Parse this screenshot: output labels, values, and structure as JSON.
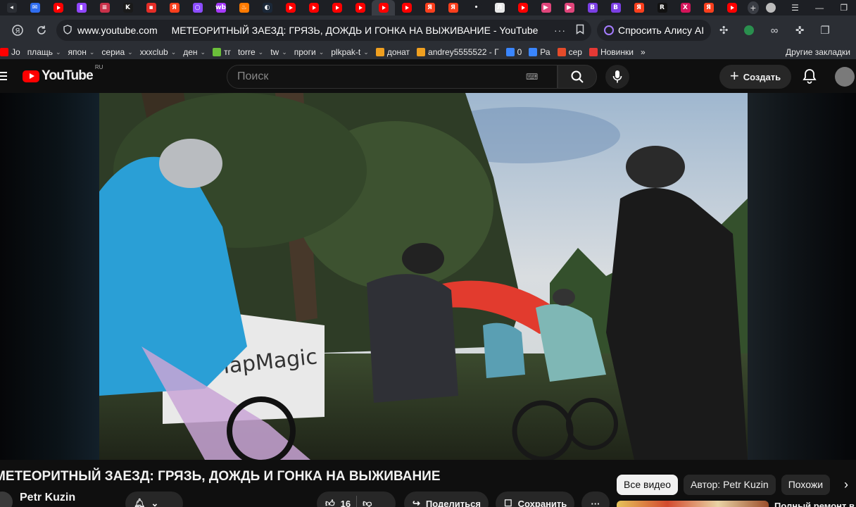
{
  "browser": {
    "tabs": [
      {
        "icon": "ya-icon",
        "color": "#2b2e34",
        "glyph": "◂"
      },
      {
        "icon": "mail-icon",
        "color": "#2f6df0",
        "glyph": "✉"
      },
      {
        "icon": "youtube-icon",
        "color": "#ff0000",
        "glyph": ""
      },
      {
        "icon": "twitch-icon",
        "color": "#9146ff",
        "glyph": "▮"
      },
      {
        "icon": "bookmark-icon",
        "color": "#c9314a",
        "glyph": "≡"
      },
      {
        "icon": "kinopoisk-icon",
        "color": "#1a1a1a",
        "glyph": "K"
      },
      {
        "icon": "live-icon",
        "color": "#e52d27",
        "glyph": "▪"
      },
      {
        "icon": "yandex-icon",
        "color": "#fc3f1d",
        "glyph": "Я"
      },
      {
        "icon": "circle-icon",
        "color": "#8b4cff",
        "glyph": "○"
      },
      {
        "icon": "wildberries-icon",
        "color": "#a73afd",
        "glyph": "wb"
      },
      {
        "icon": "fire-icon",
        "color": "#ff7a00",
        "glyph": "♨"
      },
      {
        "icon": "steam-icon",
        "color": "#1b2838",
        "glyph": "◐"
      },
      {
        "icon": "youtube-icon",
        "color": "#ff0000",
        "glyph": ""
      },
      {
        "icon": "youtube-icon",
        "color": "#ff0000",
        "glyph": ""
      },
      {
        "icon": "youtube-icon",
        "color": "#ff0000",
        "glyph": ""
      },
      {
        "icon": "youtube-icon",
        "color": "#ff0000",
        "glyph": ""
      },
      {
        "icon": "youtube-icon",
        "color": "#ff0000",
        "glyph": "",
        "active": true
      },
      {
        "icon": "youtube-icon",
        "color": "#ff0000",
        "glyph": ""
      },
      {
        "icon": "yandex-icon",
        "color": "#fc3f1d",
        "glyph": "Я"
      },
      {
        "icon": "yandex-icon",
        "color": "#fc3f1d",
        "glyph": "Я"
      },
      {
        "icon": "dots-icon",
        "color": "#1d1f24",
        "glyph": "•"
      },
      {
        "icon": "document-icon",
        "color": "#e8e8e8",
        "glyph": "Л"
      },
      {
        "icon": "youtube-icon",
        "color": "#ff0000",
        "glyph": ""
      },
      {
        "icon": "play-circle-icon",
        "color": "#e0457b",
        "glyph": "▶"
      },
      {
        "icon": "play-circle-icon",
        "color": "#e0457b",
        "glyph": "▶"
      },
      {
        "icon": "b-icon",
        "color": "#7b3fe4",
        "glyph": "B"
      },
      {
        "icon": "b-icon",
        "color": "#7b3fe4",
        "glyph": "B"
      },
      {
        "icon": "yandex-icon",
        "color": "#fc3f1d",
        "glyph": "Я"
      },
      {
        "icon": "r-icon",
        "color": "#111",
        "glyph": "R"
      },
      {
        "icon": "x-icon",
        "color": "#d4145a",
        "glyph": "X"
      },
      {
        "icon": "yandex-icon",
        "color": "#fc3f1d",
        "glyph": "Я"
      },
      {
        "icon": "youtube-icon",
        "color": "#ff0000",
        "glyph": ""
      }
    ],
    "new_tab_glyph": "+",
    "url_domain": "www.youtube.com",
    "page_title": "МЕТЕОРИТНЫЙ ЗАЕЗД: ГРЯЗЬ, ДОЖДЬ И ГОНКА НА ВЫЖИВАНИЕ - YouTube",
    "alice_label": "Спросить Алису AI"
  },
  "bookmarks": [
    {
      "label": "Jo",
      "icon_color": "#ff0000",
      "chevron": false
    },
    {
      "label": "плащь",
      "icon_color": "",
      "chevron": true
    },
    {
      "label": "япон",
      "icon_color": "",
      "chevron": true
    },
    {
      "label": "сериа",
      "icon_color": "",
      "chevron": true
    },
    {
      "label": "xxxclub",
      "icon_color": "",
      "chevron": true
    },
    {
      "label": "ден",
      "icon_color": "",
      "chevron": true
    },
    {
      "label": "тг",
      "icon_color": "#6bbf3a",
      "chevron": false
    },
    {
      "label": "torre",
      "icon_color": "",
      "chevron": true
    },
    {
      "label": "tw",
      "icon_color": "",
      "chevron": true
    },
    {
      "label": "проги",
      "icon_color": "",
      "chevron": true
    },
    {
      "label": "plkpak-t",
      "icon_color": "",
      "chevron": true
    },
    {
      "label": "донат",
      "icon_color": "#f0a020",
      "chevron": false
    },
    {
      "label": "andrey5555522 - Г",
      "icon_color": "#f0a020",
      "chevron": false
    },
    {
      "label": "0",
      "icon_color": "#3a86ff",
      "chevron": false
    },
    {
      "label": "Ра",
      "icon_color": "#3a86ff",
      "chevron": false
    },
    {
      "label": "сер",
      "icon_color": "#e54b2a",
      "chevron": false
    },
    {
      "label": "Новинки",
      "icon_color": "#e53935",
      "chevron": false
    }
  ],
  "bookmarks_more": "»",
  "bookmarks_other": "Другие закладки",
  "youtube": {
    "logo_text": "YouTube",
    "country_code": "RU",
    "search_placeholder": "Поиск",
    "create_label": "Создать",
    "video_title": "МЕТЕОРИТНЫЙ ЗАЕЗД: ГРЯЗЬ, ДОЖДЬ И ГОНКА НА ВЫЖИВАНИЕ",
    "channel_name": "Petr Kuzin",
    "likes": "16",
    "share_label": "Поделиться",
    "save_label": "Сохранить",
    "chips": [
      "Все видео",
      "Автор: Petr Kuzin",
      "Похожи"
    ],
    "recommended_title": "Полный ремонт в"
  },
  "colors": {
    "youtube_red": "#ff0000",
    "page_bg": "#0f0f0f",
    "chip_bg": "#272727"
  }
}
